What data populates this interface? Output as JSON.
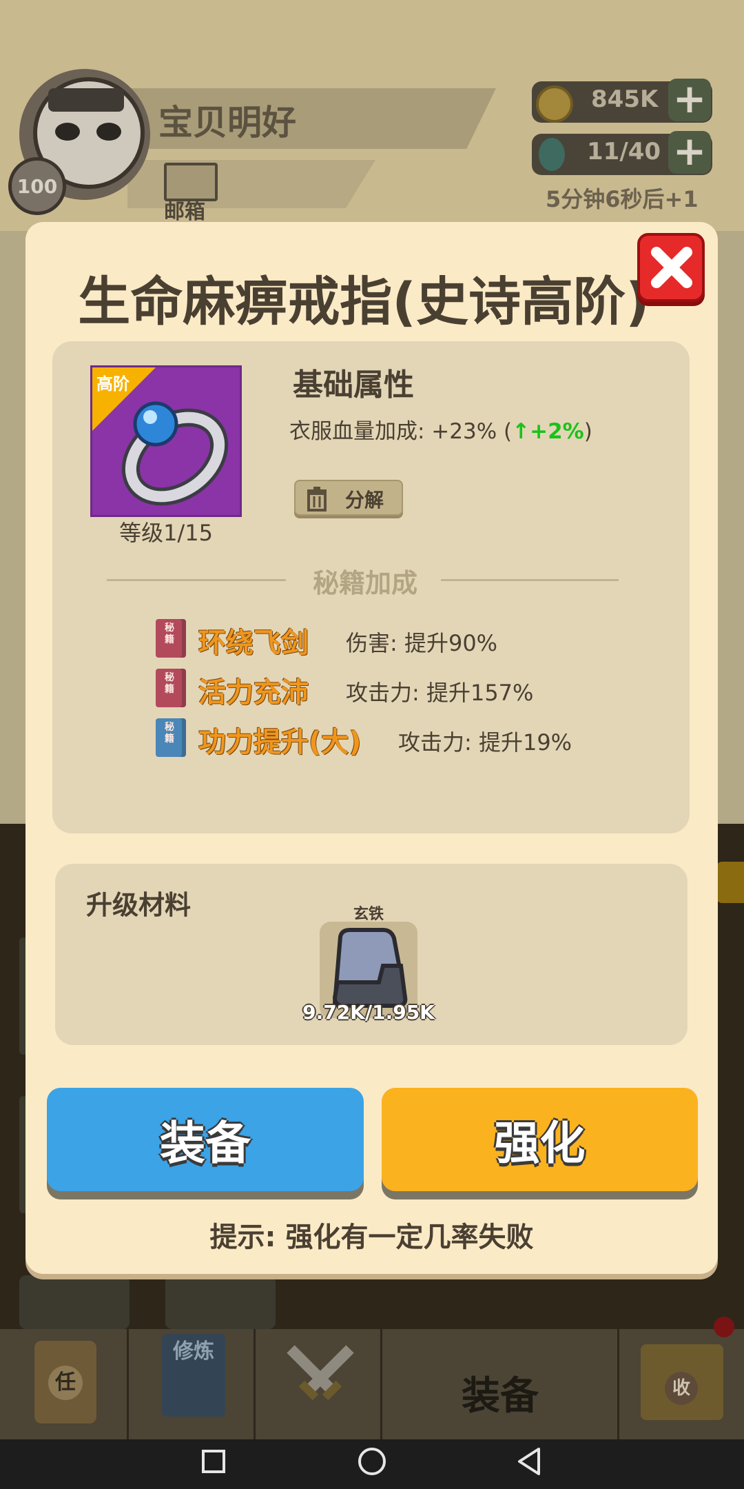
{
  "player": {
    "name": "宝贝明好",
    "level": "100",
    "mail_label": "邮箱"
  },
  "resources": {
    "coins": "845K",
    "energy": "11/40",
    "energy_timer": "5分钟6秒后+1",
    "plus_symbol": "+"
  },
  "modal": {
    "title": "生命麻痹戒指(史诗高阶)",
    "item_rank": "高阶",
    "item_level": "等级1/15",
    "base_attr_title": "基础属性",
    "base_stat_prefix": "衣服血量加成: +23% (",
    "base_stat_up": "↑+2%",
    "base_stat_suffix": ")",
    "decompose_label": "分解",
    "secret_title": "秘籍加成",
    "book_glyph": "秘籍",
    "secrets": [
      {
        "name": "环绕飞剑",
        "effect": "伤害: 提升90%",
        "color": "#b24a5c"
      },
      {
        "name": "活力充沛",
        "effect": "攻击力: 提升157%",
        "color": "#b24a5c"
      },
      {
        "name": "功力提升(大)",
        "effect": "攻击力: 提升19%",
        "color": "#4a86b8"
      }
    ],
    "materials_title": "升级材料",
    "material": {
      "name": "玄铁",
      "count": "9.72K/1.95K"
    },
    "equip_button": "装备",
    "enhance_button": "强化",
    "hint": "提示: 强化有一定几率失败"
  },
  "bottom_nav": {
    "items": [
      {
        "glyph": "任"
      },
      {
        "glyph": "修炼"
      },
      {
        "glyph": ""
      },
      {
        "label": "装备"
      },
      {
        "glyph": "收"
      }
    ]
  },
  "colors": {
    "modal_bg": "#fbeac6",
    "equip_blue": "#3ba3e6",
    "enhance_yellow": "#fbb21f",
    "item_purple": "#8a34a8",
    "stat_green": "#1bc21b",
    "secret_orange": "#f0961e",
    "close_red": "#e62a2a"
  }
}
